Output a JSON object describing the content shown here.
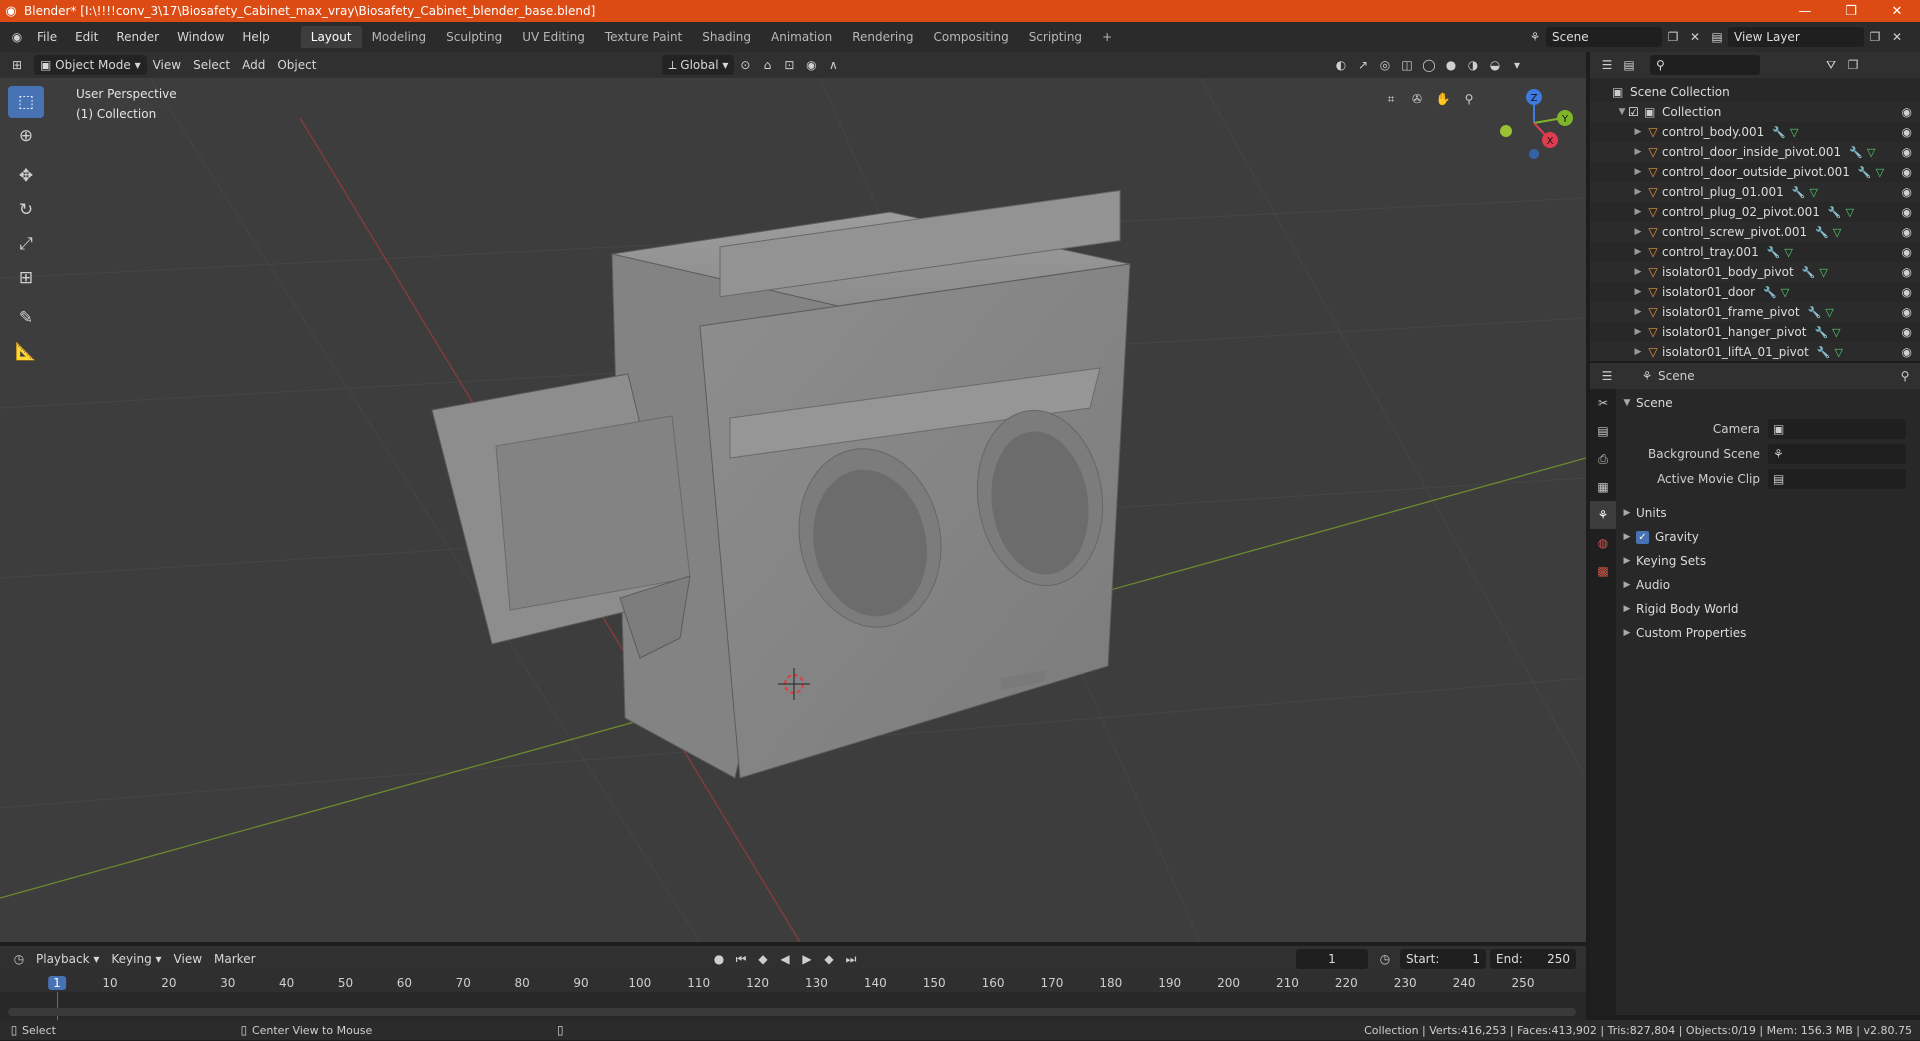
{
  "window": {
    "title": "Blender* [I:\\!!!!conv_3\\17\\Biosafety_Cabinet_max_vray\\Biosafety_Cabinet_blender_base.blend]",
    "controls": [
      "—",
      "❐",
      "✕"
    ]
  },
  "topbar": {
    "menus": [
      "File",
      "Edit",
      "Render",
      "Window",
      "Help"
    ],
    "workspaces": [
      "Layout",
      "Modeling",
      "Sculpting",
      "UV Editing",
      "Texture Paint",
      "Shading",
      "Animation",
      "Rendering",
      "Compositing",
      "Scripting"
    ],
    "active_workspace": "Layout",
    "add_workspace": "+",
    "scene": "Scene",
    "view_layer": "View Layer"
  },
  "viewport_header": {
    "mode": "Object Mode",
    "menus": [
      "View",
      "Select",
      "Add",
      "Object"
    ],
    "orientation": "Global"
  },
  "viewport": {
    "perspective": "User Perspective",
    "collection": "(1) Collection",
    "gizmo": {
      "z": "Z",
      "y": "Y",
      "x": "X"
    }
  },
  "outliner": {
    "root": "Scene Collection",
    "collection": "Collection",
    "items": [
      "control_body.001",
      "control_door_inside_pivot.001",
      "control_door_outside_pivot.001",
      "control_plug_01.001",
      "control_plug_02_pivot.001",
      "control_screw_pivot.001",
      "control_tray.001",
      "isolator01_body_pivot",
      "isolator01_door",
      "isolator01_frame_pivot",
      "isolator01_hanger_pivot",
      "isolator01_liftA_01_pivot"
    ]
  },
  "properties": {
    "context": "Scene",
    "panel": "Scene",
    "fields": [
      {
        "label": "Camera",
        "value": ""
      },
      {
        "label": "Background Scene",
        "value": ""
      },
      {
        "label": "Active Movie Clip",
        "value": ""
      }
    ],
    "subpanels": [
      "Units",
      "Gravity",
      "Keying Sets",
      "Audio",
      "Rigid Body World",
      "Custom Properties"
    ],
    "gravity_enabled": true
  },
  "timeline": {
    "menus": [
      "Playback",
      "Keying",
      "View",
      "Marker"
    ],
    "current_frame": "1",
    "start_label": "Start:",
    "start": "1",
    "end_label": "End:",
    "end": "250",
    "ticks": [
      "1",
      "10",
      "20",
      "30",
      "40",
      "50",
      "60",
      "70",
      "80",
      "90",
      "100",
      "110",
      "120",
      "130",
      "140",
      "150",
      "160",
      "170",
      "180",
      "190",
      "200",
      "210",
      "220",
      "230",
      "240",
      "250"
    ]
  },
  "statusbar": {
    "left_action": "Select",
    "middle_action": "Center View to Mouse",
    "stats": "Collection | Verts:416,253 | Faces:413,902 | Tris:827,804 | Objects:0/19 | Mem: 156.3 MB | v2.80.75"
  },
  "colors": {
    "titlebar": "#dc4b14",
    "accent": "#4772b3",
    "mesh_icon": "#e8973b",
    "data_icon": "#54d26f"
  }
}
